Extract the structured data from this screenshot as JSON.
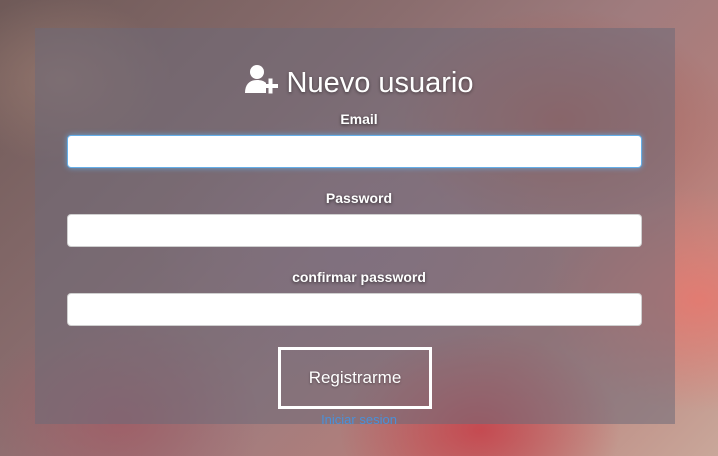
{
  "form": {
    "title": "Nuevo usuario",
    "title_icon": "user-plus-icon",
    "email_label": "Email",
    "email_value": "",
    "password_label": "Password",
    "password_value": "",
    "confirm_label": "confirmar password",
    "confirm_value": "",
    "submit_label": "Registrarme",
    "login_link": "Iniciar sesion"
  },
  "colors": {
    "focus_border": "#66afe9",
    "link": "#4a90d9",
    "button_border": "#ffffff"
  }
}
